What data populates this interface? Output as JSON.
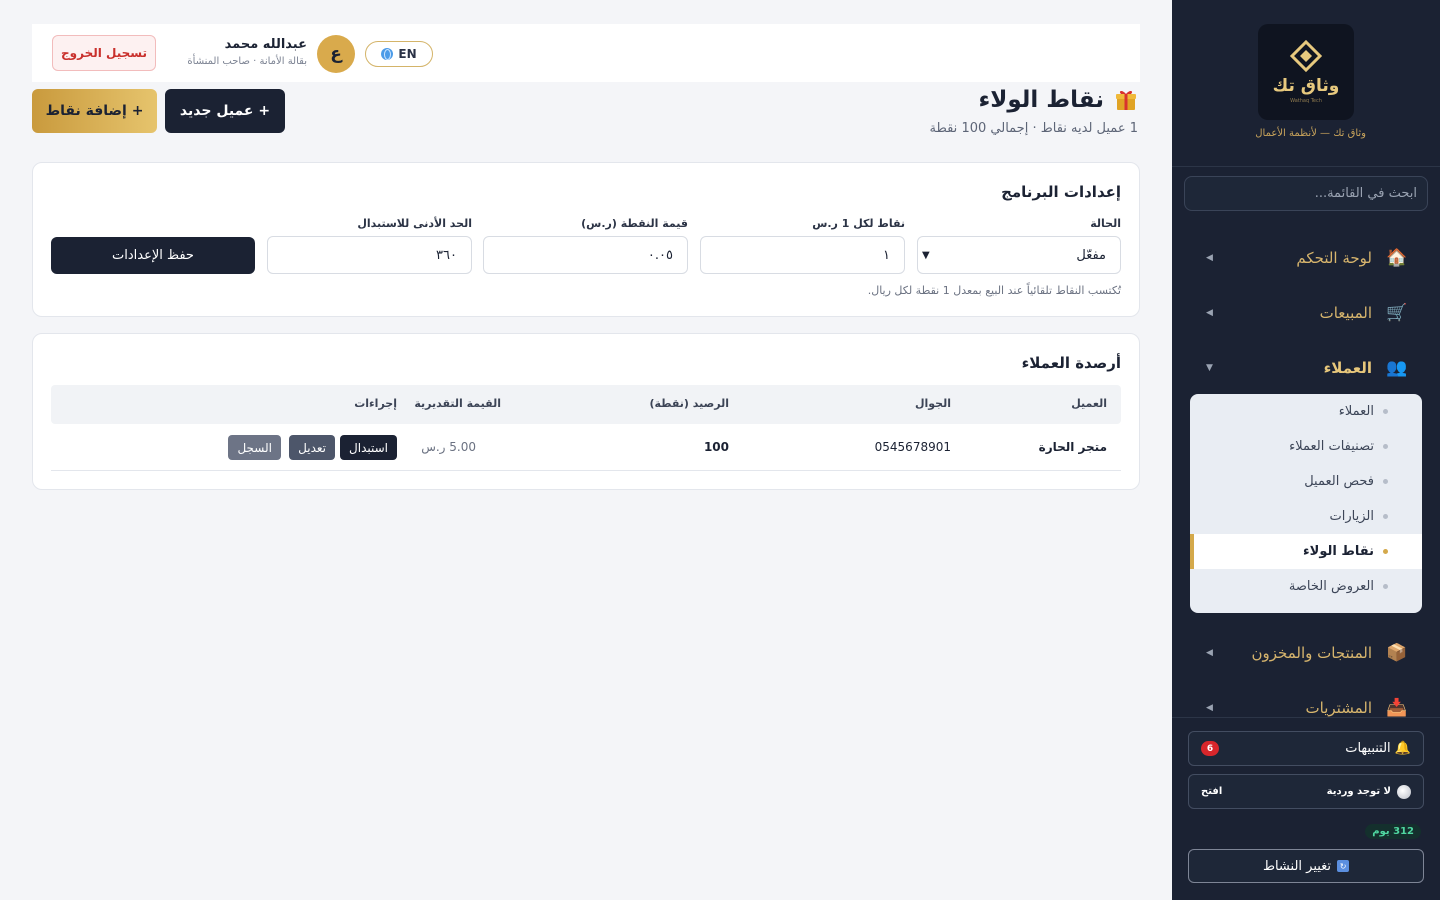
{
  "sidebar": {
    "brand_name": "وثاق تك",
    "brand_sub": "Wathaq Tech",
    "tagline": "وثاق تك — لأنظمة الأعمال",
    "search_placeholder": "ابحث في القائمة...",
    "nav": [
      {
        "label": "لوحة التحكم",
        "icon": "house-icon"
      },
      {
        "label": "المبيعات",
        "icon": "cart-icon"
      },
      {
        "label": "العملاء",
        "icon": "users-icon"
      },
      {
        "label": "المنتجات والمخزون",
        "icon": "box-icon"
      },
      {
        "label": "المشتريات",
        "icon": "inbox-icon"
      }
    ],
    "submenu": [
      {
        "label": "العملاء"
      },
      {
        "label": "تصنيفات العملاء"
      },
      {
        "label": "فحص العميل"
      },
      {
        "label": "الزيارات"
      },
      {
        "label": "نقاط الولاء"
      },
      {
        "label": "العروض الخاصة"
      }
    ],
    "notifications_label": "التنبيهات",
    "notifications_count": "6",
    "shift_status": "لا توجد وردية",
    "shift_open": "افتح",
    "days_badge": "312 يوم",
    "change_activity": "تغيير النشاط"
  },
  "topbar": {
    "lang": "EN",
    "avatar_letter": "ع",
    "user_name": "عبدالله محمد",
    "user_role": "بقالة الأمانة · صاحب المنشأة",
    "logout": "تسجيل الخروج"
  },
  "header": {
    "title": "نقاط الولاء",
    "subtitle": "1 عميل لديه نقاط · إجمالي 100 نقطة",
    "new_customer": "+ عميل جديد",
    "add_points": "+ إضافة نقاط"
  },
  "settings": {
    "title": "إعدادات البرنامج",
    "status_label": "الحالة",
    "status_value": "مفعّل",
    "points_per_label": "نقاط لكل 1 ر.س",
    "points_per_value": "١",
    "point_value_label": "قيمة النقطة (ر.س)",
    "point_value_value": "٠.٠٥",
    "min_redeem_label": "الحد الأدنى للاستبدال",
    "min_redeem_value": "٣٦٠",
    "save": "حفظ الإعدادات",
    "help": "تُكتسب النقاط تلقائياً عند البيع بمعدل 1 نقطة لكل ريال."
  },
  "balances": {
    "title": "أرصدة العملاء",
    "columns": [
      "العميل",
      "الجوال",
      "الرصيد (نقطة)",
      "القيمة التقديرية",
      "إجراءات"
    ],
    "rows": [
      {
        "customer": "متجر الحارة",
        "phone": "0545678901",
        "balance": "100",
        "value": "5.00 ر.س"
      }
    ],
    "actions": {
      "redeem": "استبدال",
      "edit": "تعديل",
      "log": "السجل"
    }
  },
  "colors": {
    "sidebar_bg": "#1b2233",
    "gold": "#d7b56d",
    "accent_gold": "#d4a94b",
    "danger": "#c9302c"
  }
}
